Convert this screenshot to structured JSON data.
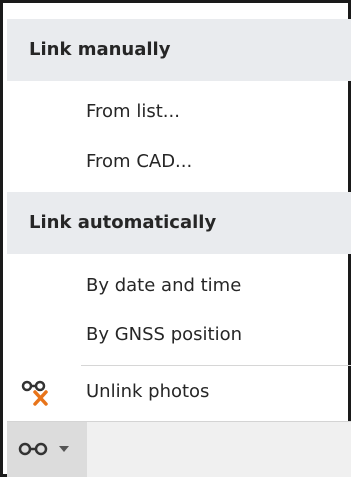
{
  "menu": {
    "manual_header": "Link manually",
    "from_list": "From list...",
    "from_cad": "From CAD...",
    "auto_header": "Link automatically",
    "by_date_time": "By date and time",
    "by_gnss": "By GNSS position",
    "unlink": "Unlink photos"
  },
  "icons": {
    "unlink": "unlink-chain-icon",
    "link_dropdown": "link-chain-icon",
    "accent_color": "#e8741a",
    "icon_color": "#333333"
  }
}
